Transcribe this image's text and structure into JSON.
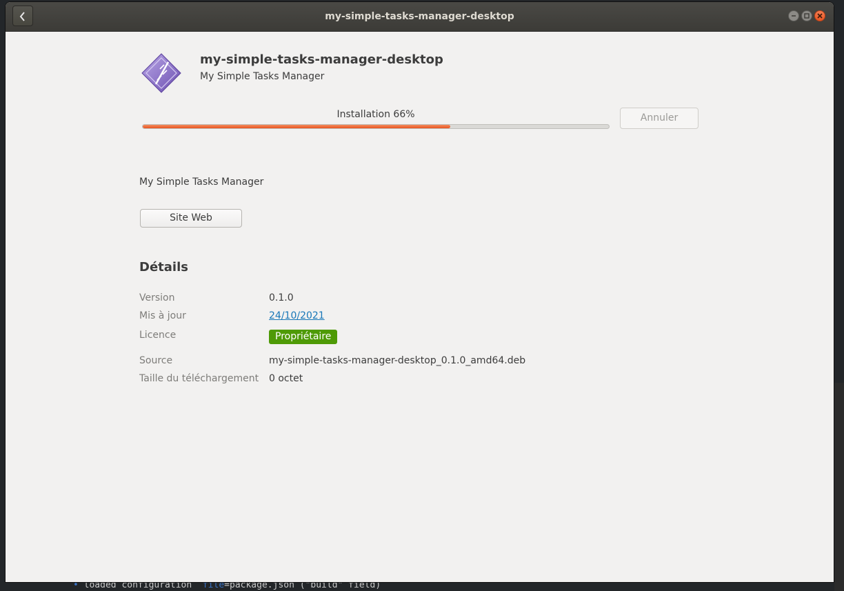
{
  "window": {
    "title": "my-simple-tasks-manager-desktop",
    "back_icon": "chevron-left-icon",
    "controls": [
      "minimize",
      "maximize",
      "close"
    ]
  },
  "app": {
    "name": "my-simple-tasks-manager-desktop",
    "summary": "My Simple Tasks Manager",
    "icon": "package-icon",
    "description": "My Simple Tasks Manager"
  },
  "install": {
    "label": "Installation 66%",
    "progress": 66,
    "cancel_label": "Annuler"
  },
  "website_label": "Site Web",
  "details": {
    "heading": "Détails",
    "version": {
      "label": "Version",
      "value": "0.1.0"
    },
    "updated": {
      "label": "Mis à jour",
      "value": "24/10/2021"
    },
    "license": {
      "label": "Licence",
      "value": "Propriétaire"
    },
    "source": {
      "label": "Source",
      "value": "my-simple-tasks-manager-desktop_0.1.0_amd64.deb"
    },
    "download_size": {
      "label": "Taille du téléchargement",
      "value": "0 octet"
    }
  },
  "background_terminal": {
    "line_bullet": "•",
    "line_prefix": "loaded configuration",
    "line_key": "file",
    "line_rest": "=package.json (\"build\" field)"
  },
  "colors": {
    "accent": "#e95420",
    "license_badge": "#4e9a06",
    "link": "#1877b8",
    "titlebar": "#3c3b37"
  }
}
